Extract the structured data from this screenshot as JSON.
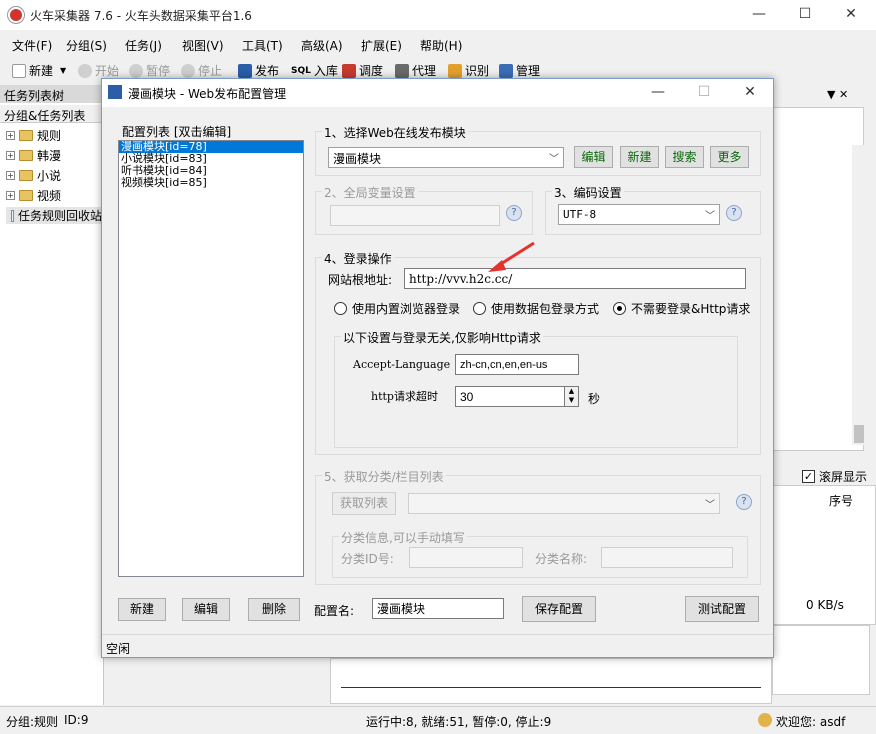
{
  "app": {
    "title": "火车采集器 7.6 - 火车头数据采集平台1.6",
    "window_controls": {
      "minimize": "—",
      "maximize": "☐",
      "close": "✕"
    }
  },
  "menu": [
    "文件(F)",
    "分组(S)",
    "任务(J)",
    "视图(V)",
    "工具(T)",
    "高级(A)",
    "扩展(E)",
    "帮助(H)"
  ],
  "toolbar": {
    "new": "新建",
    "start": "开始",
    "pause": "暂停",
    "stop": "停止",
    "publish": "发布",
    "storage": "入库",
    "debug": "调度",
    "proxy": "代理",
    "recognize": "识别",
    "manage": "管理",
    "sql_badge": "SQL"
  },
  "left_panel": {
    "header": "任务列表树",
    "subheader": "分组&任务列表",
    "items": [
      "规则",
      "韩漫",
      "小说",
      "视频",
      "任务规则回收站"
    ]
  },
  "right_panel": {
    "close_glyph": "▼ ✕",
    "checkbox_label": "滚屏显示",
    "col_header": "序号",
    "speed": "0 KB/s"
  },
  "status": {
    "left": "分组:规则",
    "id": "ID:9",
    "counts": "运行中:8, 就绪:51, 暂停:0, 停止:9",
    "user": "欢迎您:  asdf"
  },
  "dialog": {
    "title": "漫画模块 - Web发布配置管理",
    "list_header": "配置列表 [双击编辑]",
    "list_items": [
      "漫画模块[id=78]",
      "小说模块[id=83]",
      "听书模块[id=84]",
      "视频模块[id=85]"
    ],
    "section1": {
      "title": "1、选择Web在线发布模块",
      "selected_module": "漫画模块",
      "buttons": [
        "编辑",
        "新建",
        "搜索",
        "更多"
      ]
    },
    "section2": {
      "title": "2、全局变量设置"
    },
    "section3": {
      "title": "3、编码设置",
      "encoding": "UTF-8"
    },
    "section4": {
      "title": "4、登录操作",
      "site_label": "网站根地址:",
      "site_value": "http://vvv.h2c.cc/",
      "radios": [
        "使用内置浏览器登录",
        "使用数据包登录方式",
        "不需要登录&Http请求"
      ],
      "selected_radio": 2,
      "sub_title": "以下设置与登录无关,仅影响Http请求",
      "accept_label": "Accept-Language",
      "accept_value": "zh-cn,cn,en,en-us",
      "timeout_label": "http请求超时",
      "timeout_value": "30",
      "timeout_unit": "秒"
    },
    "section5": {
      "title": "5、获取分类/栏目列表",
      "fetch_button": "获取列表",
      "info_title": "分类信息,可以手动填写",
      "id_label": "分类ID号:",
      "name_label": "分类名称:"
    },
    "bottom": {
      "new": "新建",
      "edit": "编辑",
      "delete": "删除",
      "config_name_label": "配置名:",
      "config_name_value": "漫画模块",
      "save": "保存配置",
      "test": "测试配置"
    },
    "status_text": "空闲",
    "help_glyph": "?"
  }
}
